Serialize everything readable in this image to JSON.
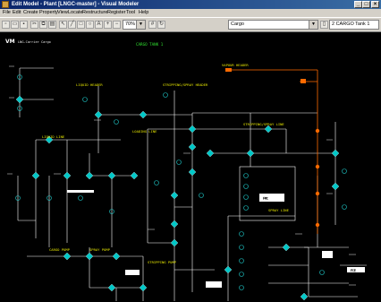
{
  "window": {
    "title": "Edit Model - Plant [LNGC-master] - Visual Modeler",
    "minimize": "_",
    "maximize": "□",
    "close": "×"
  },
  "menu": [
    "File",
    "Edit",
    "Create",
    "Property",
    "View",
    "Locate",
    "Restructure",
    "Register",
    "Tool",
    "Help"
  ],
  "toolbar": {
    "zoom_value": "70%",
    "model_selector": "Cargo",
    "view_selector": "2 CARGO Tank 1"
  },
  "diagram": {
    "title": "CARGO TANK 1",
    "logo": "VM",
    "logo_caption": "LNG-Carrier Cargo",
    "yellow_labels": [
      "LIQUID HEADER",
      "STRIPPING/SPRAY HEADER",
      "VAPOUR HEADER",
      "LOADING LINE",
      "STRIPPING/SPRAY LINE",
      "SPRAY LINE",
      "LIQUID LINE",
      "STRIPPING PUMP",
      "CARGO PUMP",
      "SPRAY PUMP"
    ],
    "colors": {
      "background": "#000000",
      "line": "#ffffff",
      "vapour_line": "#ff6a00",
      "valve": "#00c8c8",
      "instrument": "#1ec8c8",
      "title": "#30e030",
      "header_label": "#e8e800"
    }
  }
}
